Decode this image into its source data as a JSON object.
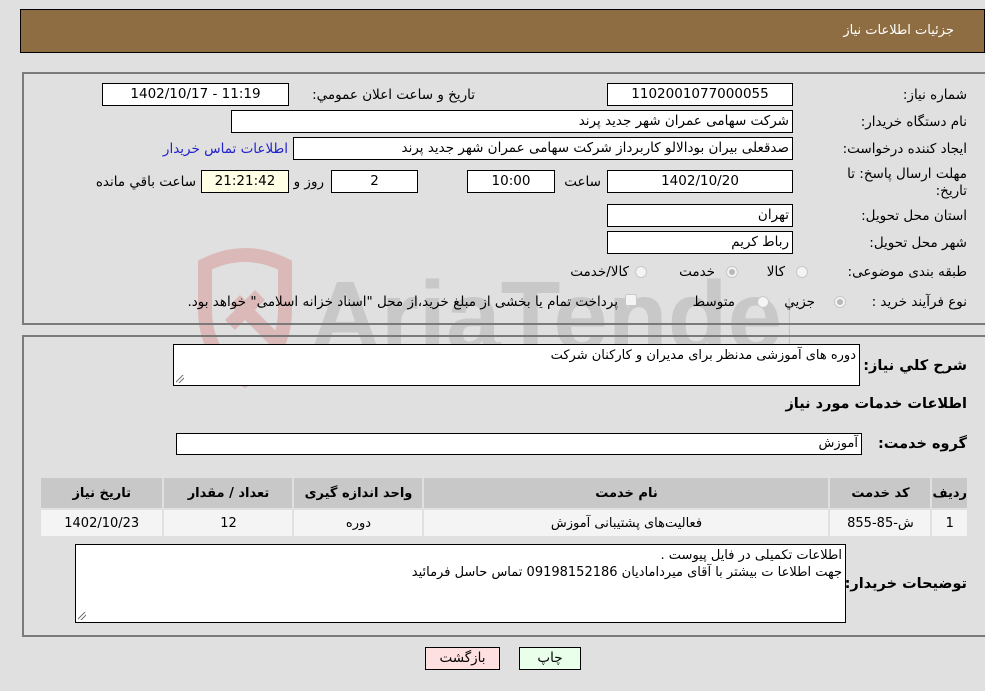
{
  "header": {
    "title": "جزئیات اطلاعات نیاز"
  },
  "form": {
    "need_number": {
      "label": "شماره نیاز:",
      "value": "1102001077000055"
    },
    "announce_datetime": {
      "label": "تاریخ و ساعت اعلان عمومي:",
      "value": "1402/10/17 - 11:19"
    },
    "buyer_org": {
      "label": "نام دستگاه خریدار:",
      "value": "شرکت سهامی عمران شهر جدید پرند"
    },
    "creator": {
      "label": "ایجاد کننده درخواست:",
      "value": "صدقعلی بیران بودالالو کاربرداز شرکت سهامی عمران شهر جدید پرند"
    },
    "buyer_contact_link": "اطلاعات تماس خریدار",
    "deadline": {
      "label_line1": "مهلت ارسال پاسخ: تا",
      "label_line2": "تاریخ:",
      "date": "1402/10/20",
      "time_label": "ساعت",
      "time": "10:00",
      "days": "2",
      "days_label": "روز و",
      "remaining": "21:21:42",
      "remaining_label": "ساعت باقي مانده"
    },
    "province": {
      "label": "استان محل تحویل:",
      "value": "تهران"
    },
    "city": {
      "label": "شهر محل تحویل:",
      "value": "رباط کریم"
    },
    "category": {
      "label": "طبقه بندی موضوعی:",
      "options": [
        {
          "label": "کالا",
          "checked": false
        },
        {
          "label": "خدمت",
          "checked": true
        },
        {
          "label": "کالا/خدمت",
          "checked": false
        }
      ]
    },
    "process": {
      "label": "نوع فرآیند خرید :",
      "options": [
        {
          "label": "جزيي",
          "checked": true
        },
        {
          "label": "متوسط",
          "checked": false
        }
      ],
      "treasury_note": "پرداخت تمام یا بخشی از مبلغ خرید،از محل \"اسناد خزانه اسلامی\" خواهد بود."
    }
  },
  "details": {
    "summary_label": "شرح کلي نياز:",
    "summary": "دوره های آموزشی مدنظر برای مدیران و کارکنان شرکت",
    "services_heading": "اطلاعات خدمات مورد نیاز",
    "service_group_label": "گروه خدمت:",
    "service_group": "آموزش",
    "table": {
      "headers": [
        "ردیف",
        "کد خدمت",
        "نام خدمت",
        "واحد اندازه گیری",
        "تعداد / مقدار",
        "تاریخ نیاز"
      ],
      "rows": [
        [
          "1",
          "ش-85-855",
          "فعالیت‌های پشتیبانی آموزش",
          "دوره",
          "12",
          "1402/10/23"
        ]
      ]
    },
    "buyer_notes_label": "توضیحات خریدار:",
    "buyer_notes_line1": "اطلاعات تکمیلی در فایل پیوست .",
    "buyer_notes_line2": "جهت اطلاعا ت بیشتر با آقای میرداماديان 09198152186 تماس حاسل فرمائید"
  },
  "buttons": {
    "print": "چاپ",
    "back": "بازگشت"
  },
  "watermark": "AriaTender.neT",
  "colors": {
    "header_bg": "#8e6d42",
    "print_bg": "#eaffea",
    "back_bg": "#ffe0e0",
    "link": "#2222cc"
  }
}
